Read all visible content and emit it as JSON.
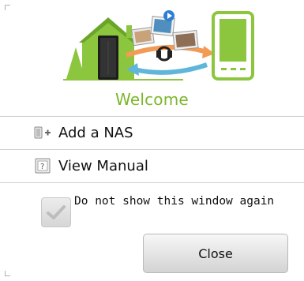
{
  "header": {
    "title": "Welcome",
    "accent_color": "#7db62d"
  },
  "menu": {
    "items": [
      {
        "label": "Add a NAS",
        "icon": "add-nas-icon"
      },
      {
        "label": "View Manual",
        "icon": "manual-icon"
      }
    ]
  },
  "options": {
    "dont_show_label": "Do not show this window again",
    "dont_show_checked": true
  },
  "footer": {
    "close_label": "Close"
  },
  "illustration": {
    "description_icons": [
      "house-icon",
      "nas-tower-icon",
      "media-photos-icon",
      "sync-arrows-icon",
      "mobile-phone-icon"
    ]
  }
}
